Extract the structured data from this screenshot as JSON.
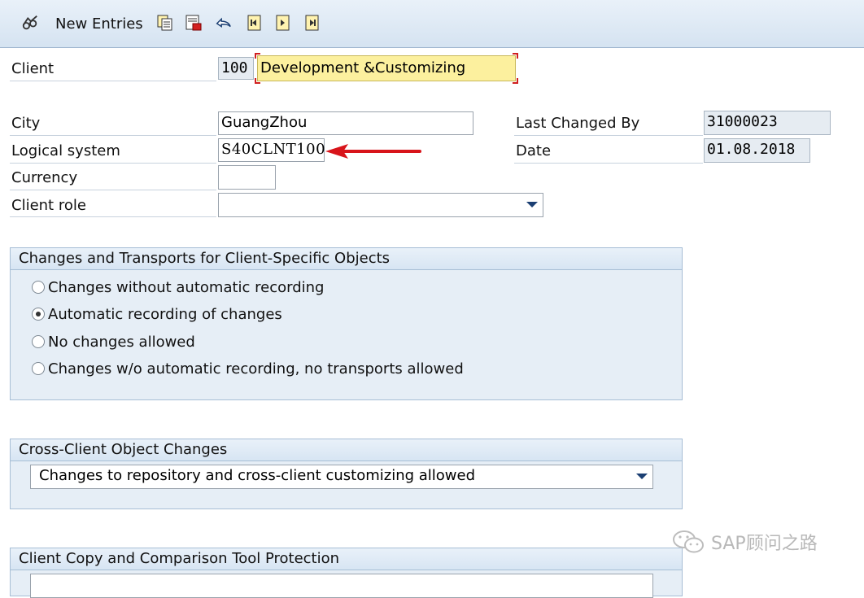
{
  "toolbar": {
    "new_entries_label": "New Entries",
    "icons": [
      "glasses-icon",
      "copy-icon",
      "save-icon",
      "undo-icon",
      "first-page-icon",
      "next-page-icon",
      "last-page-icon"
    ]
  },
  "form": {
    "client_label": "Client",
    "client_number": "100",
    "client_name": "Development &Customizing",
    "city_label": "City",
    "city_value": "GuangZhou",
    "logical_system_label": "Logical system",
    "logical_system_value": "S40CLNT100",
    "currency_label": "Currency",
    "currency_value": "",
    "client_role_label": "Client role",
    "client_role_value": "",
    "last_changed_by_label": "Last Changed By",
    "last_changed_by_value": "31000023",
    "date_label": "Date",
    "date_value": "01.08.2018"
  },
  "changes_transports": {
    "title": "Changes and Transports for Client-Specific Objects",
    "options": [
      {
        "label": "Changes without automatic recording",
        "selected": false
      },
      {
        "label": "Automatic recording of changes",
        "selected": true
      },
      {
        "label": "No changes allowed",
        "selected": false
      },
      {
        "label": "Changes w/o automatic recording, no transports allowed",
        "selected": false
      }
    ]
  },
  "cross_client": {
    "title": "Cross-Client Object Changes",
    "selected": "Changes to repository and cross-client customizing allowed"
  },
  "copy_protection": {
    "title": "Client Copy and Comparison Tool Protection"
  },
  "watermark": {
    "text": "SAP顾问之路"
  },
  "colors": {
    "toolbar_bg": "#d5e3f1",
    "group_bg": "#e6eef6",
    "highlight_field": "#fcf09e",
    "annotation_arrow": "#d8141a"
  }
}
